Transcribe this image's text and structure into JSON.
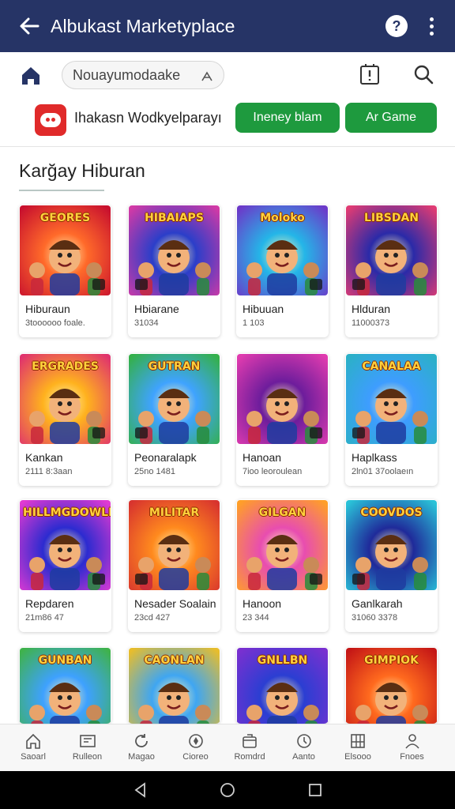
{
  "header": {
    "title": "Albukast Marketyplace",
    "help_label": "?"
  },
  "toolbar": {
    "search_text": "Nouayumodaake"
  },
  "featured": {
    "app_name": "Ihakasn Wodkyelparayı",
    "button_primary": "Ineney blam",
    "button_secondary": "Ar Game"
  },
  "section": {
    "title": "Karğay Hiburan"
  },
  "cards": [
    {
      "title": "Hiburaun",
      "sub": "3toooooo foale.",
      "art": "GEORES",
      "c1": "#ff6a2a",
      "c2": "#c8102e"
    },
    {
      "title": "Hbiarane",
      "sub": "31034",
      "art": "HIBAIAPS",
      "c1": "#2b3ec9",
      "c2": "#d23aa6"
    },
    {
      "title": "Hibuuan",
      "sub": "1 103",
      "art": "Moloko",
      "c1": "#24b6e8",
      "c2": "#6c39c9"
    },
    {
      "title": "Hlduran",
      "sub": "11000373",
      "art": "LIBSDAN",
      "c1": "#2a2aa8",
      "c2": "#e03b73"
    },
    {
      "title": "Kankan",
      "sub": "2111 8:3aan",
      "art": "ERGRADES",
      "c1": "#ffb21e",
      "c2": "#e0336d"
    },
    {
      "title": "Peonaralapk",
      "sub": "25no 1481",
      "art": "GUTRAN",
      "c1": "#3fa3ff",
      "c2": "#34b04a"
    },
    {
      "title": "Hanoan",
      "sub": "7ioo leoroulean",
      "art": "",
      "c1": "#6d1d9c",
      "c2": "#e03baf"
    },
    {
      "title": "Haplkass",
      "sub": "2ln01 37oolaeın",
      "art": "CANALAA",
      "c1": "#3e9dff",
      "c2": "#2bb0c7"
    },
    {
      "title": "Repdaren",
      "sub": "21m86 47",
      "art": "HILLMGDOWLE",
      "c1": "#2c2bd0",
      "c2": "#e13ad2"
    },
    {
      "title": "Nesader Soalain",
      "sub": "23cd 427",
      "art": "MILITAR",
      "c1": "#ff8a1e",
      "c2": "#d8342e"
    },
    {
      "title": "Hanoon",
      "sub": "23 344",
      "art": "GILGAN",
      "c1": "#e84db0",
      "c2": "#ff9f28"
    },
    {
      "title": "Ganlkarah",
      "sub": "31060 3378",
      "art": "COOVDOS",
      "c1": "#1f2a9a",
      "c2": "#2ac2d8"
    },
    {
      "title": "",
      "sub": "",
      "art": "GUNBAN",
      "c1": "#3ea1ff",
      "c2": "#3fb24c"
    },
    {
      "title": "",
      "sub": "",
      "art": "CAONLAN",
      "c1": "#3fa6f2",
      "c2": "#e8bd2c"
    },
    {
      "title": "",
      "sub": "",
      "art": "GNLLBN",
      "c1": "#2b3ed2",
      "c2": "#7a30d0"
    },
    {
      "title": "",
      "sub": "",
      "art": "GIMPIOK",
      "c1": "#ff6a1e",
      "c2": "#c41616"
    }
  ],
  "nav": [
    {
      "label": "Saoarl",
      "icon": "home-icon"
    },
    {
      "label": "Rulleon",
      "icon": "library-icon"
    },
    {
      "label": "Magao",
      "icon": "refresh-icon"
    },
    {
      "label": "Cioreo",
      "icon": "compass-icon"
    },
    {
      "label": "Romdrd",
      "icon": "package-icon"
    },
    {
      "label": "Aanto",
      "icon": "clock-icon"
    },
    {
      "label": "Elsooo",
      "icon": "grid-icon"
    },
    {
      "label": "Fnoes",
      "icon": "person-icon"
    }
  ],
  "colors": {
    "header_bg": "#263466",
    "accent_green": "#1e9a3e",
    "logo_red": "#e02a2a"
  }
}
